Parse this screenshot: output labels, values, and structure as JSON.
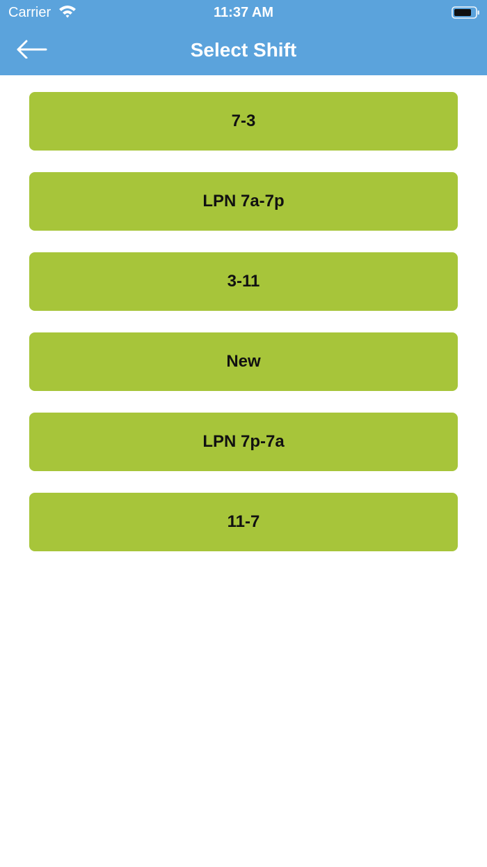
{
  "status_bar": {
    "carrier": "Carrier",
    "time": "11:37 AM",
    "wifi_icon": "wifi-icon",
    "battery_icon": "battery-icon"
  },
  "header": {
    "title": "Select Shift",
    "back_icon": "arrow-left-icon",
    "background_color": "#5ba3dc"
  },
  "shifts": [
    {
      "label": "7-3"
    },
    {
      "label": "LPN 7a-7p"
    },
    {
      "label": "3-11"
    },
    {
      "label": "New"
    },
    {
      "label": "LPN 7p-7a"
    },
    {
      "label": "11-7"
    }
  ],
  "colors": {
    "shift_button": "#a7c53a",
    "shift_text": "#111111"
  }
}
